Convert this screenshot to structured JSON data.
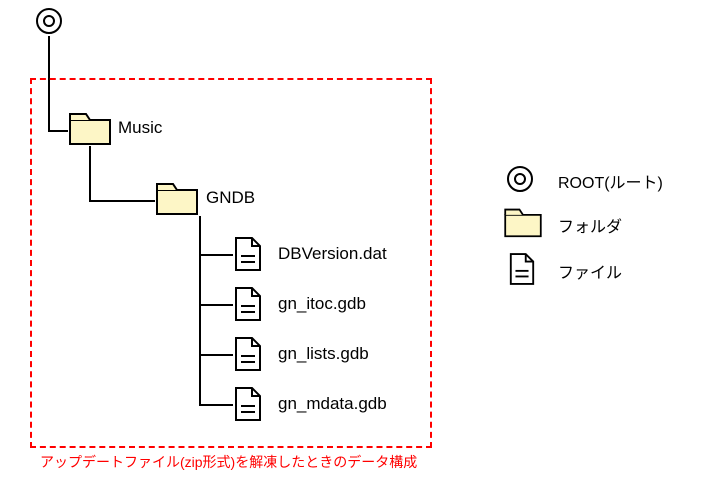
{
  "tree": {
    "root_folder": "Music",
    "sub_folder": "GNDB",
    "files": [
      "DBVersion.dat",
      "gn_itoc.gdb",
      "gn_lists.gdb",
      "gn_mdata.gdb"
    ]
  },
  "legend": {
    "root_label": "ROOT(ルート)",
    "folder_label": "フォルダ",
    "file_label": "ファイル"
  },
  "caption": "アップデートファイル(zip形式)を解凍したときのデータ構成"
}
